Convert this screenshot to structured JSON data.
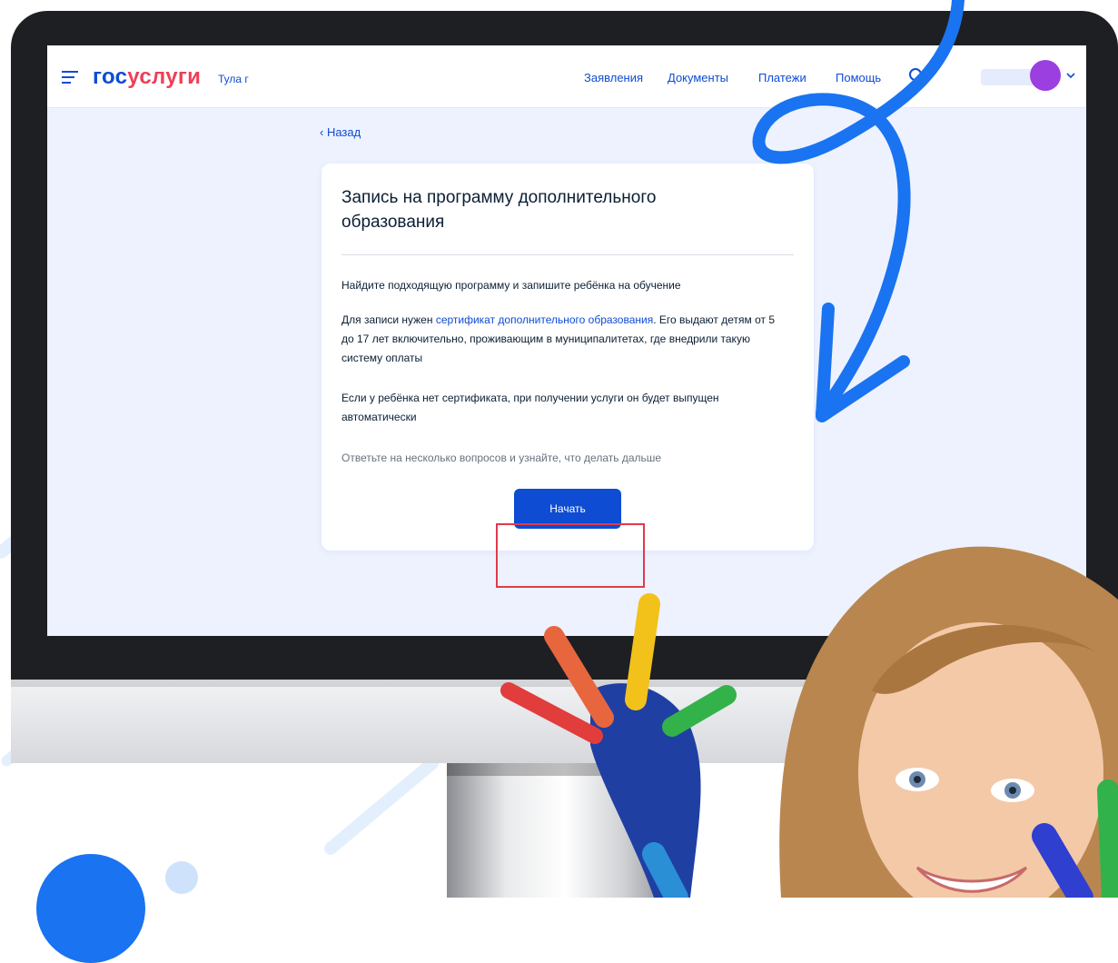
{
  "header": {
    "logo_part1": "гос",
    "logo_part2": "услуги",
    "city": "Тула г",
    "nav": [
      "Заявления",
      "Документы",
      "Платежи",
      "Помощь"
    ]
  },
  "back_label": "Назад",
  "card": {
    "title": "Запись на программу дополнительного образования",
    "intro": "Найдите подходящую программу и запишите ребёнка на обучение",
    "para2_before": "Для записи нужен ",
    "para2_link": "сертификат дополнительного образования",
    "para2_after": ". Его выдают детям от 5 до 17 лет включительно, проживающим в муниципалитетах, где внедрили такую систему оплаты",
    "para3": "Если у ребёнка нет сертификата, при получении услуги он будет выпущен автоматически",
    "hint": "Ответьте на несколько вопросов и узнайте, что делать дальше",
    "start_button": "Начать"
  },
  "icons": {
    "menu": "hamburger-icon",
    "search": "search-icon",
    "user": "avatar",
    "dropdown": "chevron-down-icon",
    "back": "chevron-left-icon"
  },
  "colors": {
    "accent": "#0d4cd3",
    "brand_red": "#ee3f58",
    "highlight": "#e03a4c",
    "arrow": "#1a73f0",
    "avatar": "#9b3fe0"
  }
}
